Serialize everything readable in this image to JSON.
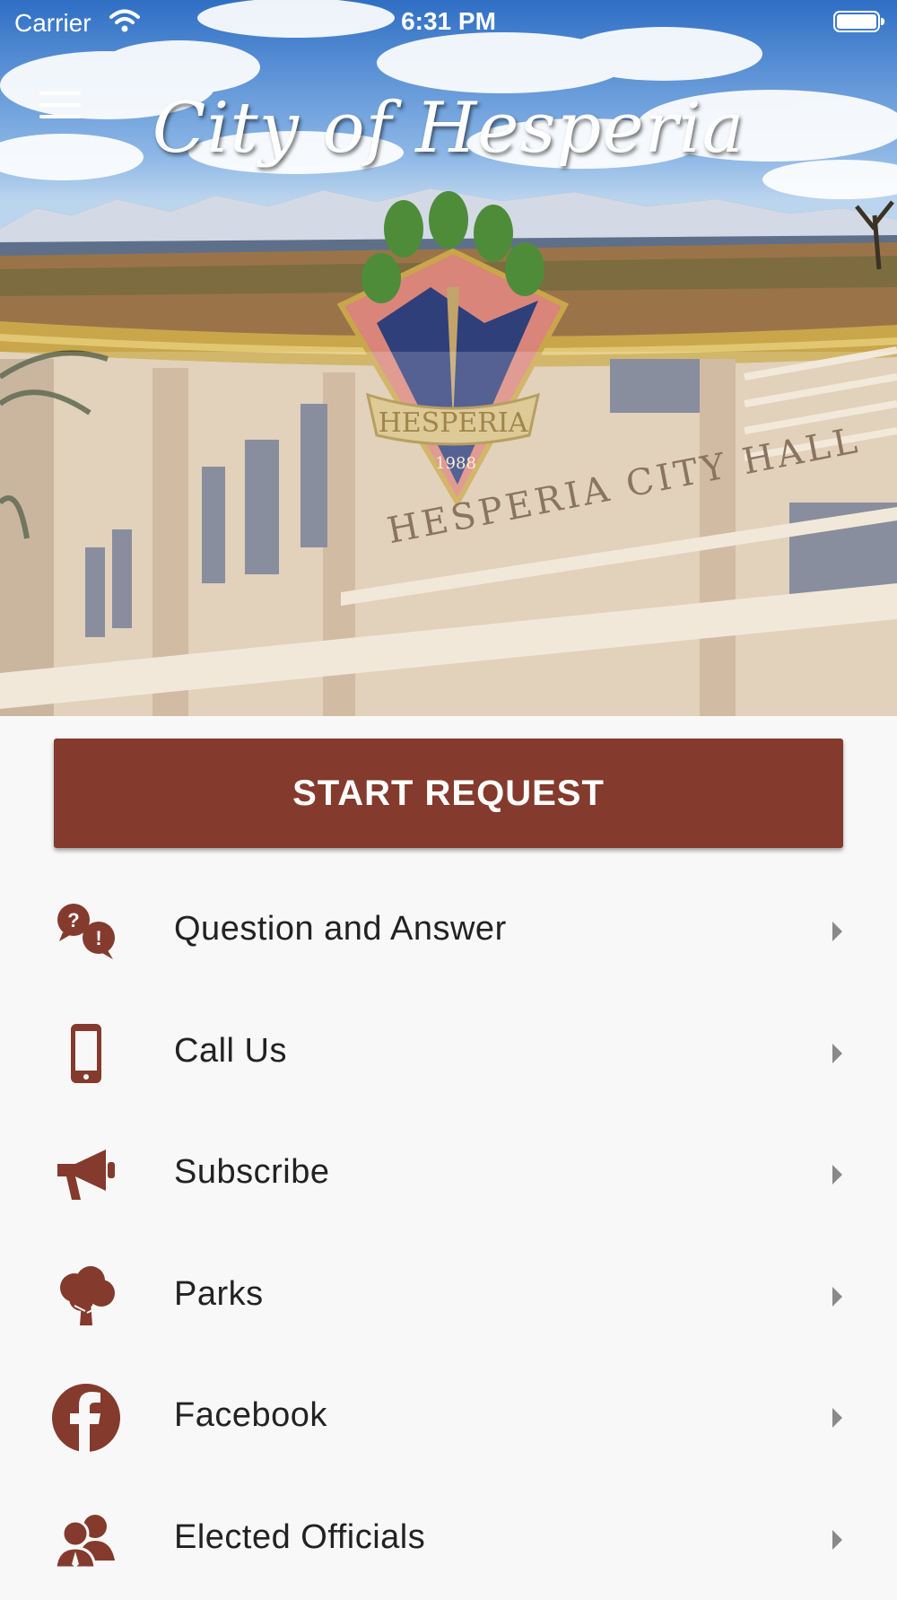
{
  "status_bar": {
    "carrier": "Carrier",
    "time": "6:31 PM"
  },
  "header": {
    "title": "City of Hesperia",
    "seal_text": "HESPERIA",
    "seal_year": "1988",
    "building_sign": "HESPERIA CITY HALL"
  },
  "start_request": {
    "label": "START REQUEST"
  },
  "menu": [
    {
      "label": "Question and Answer",
      "icon": "question-answer-icon"
    },
    {
      "label": "Call Us",
      "icon": "phone-icon"
    },
    {
      "label": "Subscribe",
      "icon": "megaphone-icon"
    },
    {
      "label": "Parks",
      "icon": "tree-icon"
    },
    {
      "label": "Facebook",
      "icon": "facebook-icon"
    },
    {
      "label": "Elected Officials",
      "icon": "officials-icon"
    }
  ],
  "colors": {
    "accent": "#843a2c",
    "chevron": "#8a8a8a",
    "background": "#f8f8f8"
  }
}
